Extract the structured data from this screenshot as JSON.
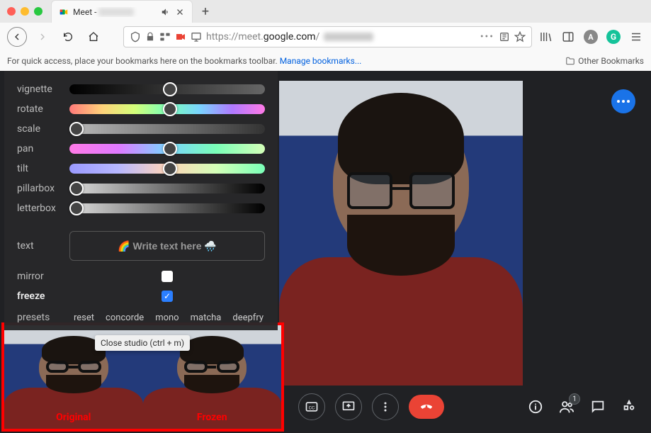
{
  "browser": {
    "tab": {
      "title_prefix": "Meet - ",
      "audio_icon": "audio-icon",
      "close_icon": "close-icon"
    },
    "url": {
      "scheme": "https://",
      "sub": "meet.",
      "domain": "google.com",
      "path_prefix": "/"
    },
    "bookmark_msg": "For quick access, place your bookmarks here on the bookmarks toolbar. ",
    "bookmark_link": "Manage bookmarks...",
    "other_bookmarks": "Other Bookmarks"
  },
  "controls": {
    "sliders": [
      {
        "label": "vignette",
        "grad": "g-dark",
        "pos": 48
      },
      {
        "label": "rotate",
        "grad": "g-rainbow",
        "pos": 48
      },
      {
        "label": "scale",
        "grad": "g-gray",
        "pos": 0
      },
      {
        "label": "pan",
        "grad": "g-pan",
        "pos": 48
      },
      {
        "label": "tilt",
        "grad": "g-tilt",
        "pos": 48
      },
      {
        "label": "pillarbox",
        "grad": "g-box",
        "pos": 0
      },
      {
        "label": "letterbox",
        "grad": "g-box",
        "pos": 0
      }
    ],
    "text_label": "text",
    "text_placeholder": "🌈 Write text here 🌧️",
    "mirror_label": "mirror",
    "mirror_checked": false,
    "freeze_label": "freeze",
    "freeze_checked": true,
    "presets_label": "presets",
    "presets": [
      "reset",
      "concorde",
      "mono",
      "matcha",
      "deepfry"
    ]
  },
  "thumbnails": {
    "original": "Original",
    "frozen": "Frozen",
    "tooltip": "Close studio (ctrl + m)"
  },
  "bottom": {
    "participants_badge": "1"
  }
}
